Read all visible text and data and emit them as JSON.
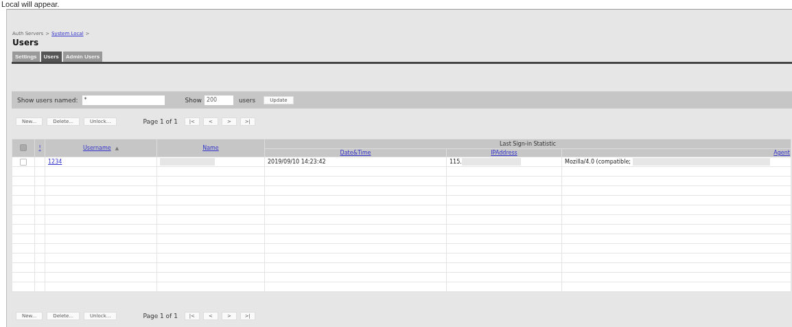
{
  "caption": "Local will appear.",
  "breadcrumb": [
    {
      "label": "Auth Servers",
      "link": false
    },
    {
      "label": "System Local",
      "link": true
    }
  ],
  "breadcrumb_separator": ">",
  "title": "Users",
  "tabs": [
    {
      "label": "Settings",
      "selected": false
    },
    {
      "label": "Users",
      "selected": true
    },
    {
      "label": "Admin Users",
      "selected": false
    }
  ],
  "filter": {
    "label": "Show users named:",
    "value": "*",
    "show_label": "Show",
    "count": "200",
    "users_label": "users",
    "button": "Update"
  },
  "actions": [
    "New...",
    "Delete...",
    "Unlock..."
  ],
  "pager": {
    "text": "Page 1 of 1",
    "buttons": [
      "|<",
      "<",
      ">",
      ">|"
    ]
  },
  "table": {
    "columns": {
      "flag": "!",
      "username": "Username",
      "sort_indicator": "▲",
      "name": "Name",
      "group": "Last Sign-in Statistic",
      "datetime": "Date&Time",
      "ip": "IPAddress",
      "agent": "Agent"
    },
    "rows": [
      {
        "checked": false,
        "username": "1234",
        "datetime": "2019/09/10 14:23:42",
        "ip": "115.",
        "agent": "Mozilla/4.0 (compatible;"
      }
    ]
  },
  "bottom_actions": [
    "New...",
    "Delete...",
    "Unlock..."
  ],
  "bottom_pager": {
    "text": "Page 1 of 1",
    "buttons": [
      "|<",
      "<",
      ">",
      ">|"
    ]
  }
}
